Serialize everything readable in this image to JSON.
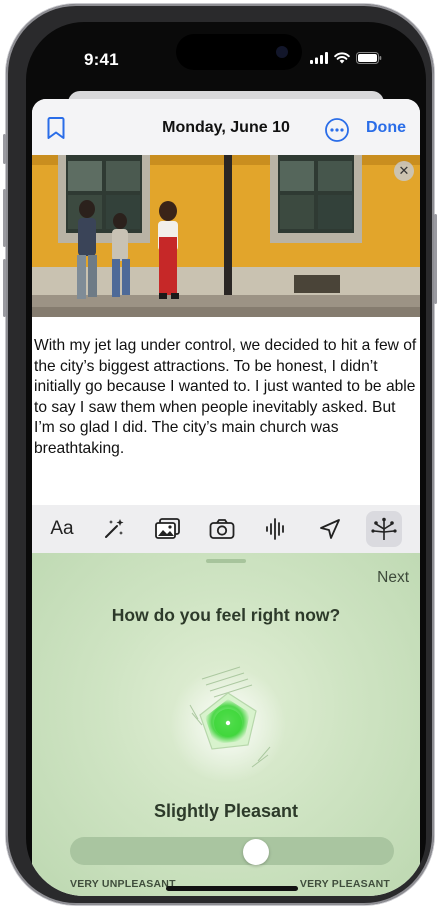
{
  "status_bar": {
    "time": "9:41"
  },
  "nav": {
    "title": "Monday, June 10",
    "done_label": "Done"
  },
  "entry": {
    "text": "With my jet lag under control, we decided to hit a few of the city’s biggest attractions. To be honest, I didn’t initially go because I wanted to. I just wanted to be able to say I saw them when people inevitably asked. But I’m so glad I did. The city’s main church was breathtaking."
  },
  "toolbar": {
    "items": [
      {
        "icon": "text-format-icon",
        "label": "Aa"
      },
      {
        "icon": "magic-wand-icon"
      },
      {
        "icon": "photo-library-icon"
      },
      {
        "icon": "camera-icon"
      },
      {
        "icon": "audio-waveform-icon"
      },
      {
        "icon": "location-icon"
      },
      {
        "icon": "state-of-mind-icon",
        "active": true
      }
    ]
  },
  "mood": {
    "next_label": "Next",
    "question": "How do you feel right now?",
    "state_label": "Slightly Pleasant",
    "slider_value": 0.58,
    "slider_min_label": "VERY UNPLEASANT",
    "slider_max_label": "VERY PLEASANT"
  },
  "colors": {
    "accent": "#2a6de8",
    "mood_background": "#cfe4c3",
    "mood_glow": "#5ee35a",
    "building": "#e0a72a"
  }
}
